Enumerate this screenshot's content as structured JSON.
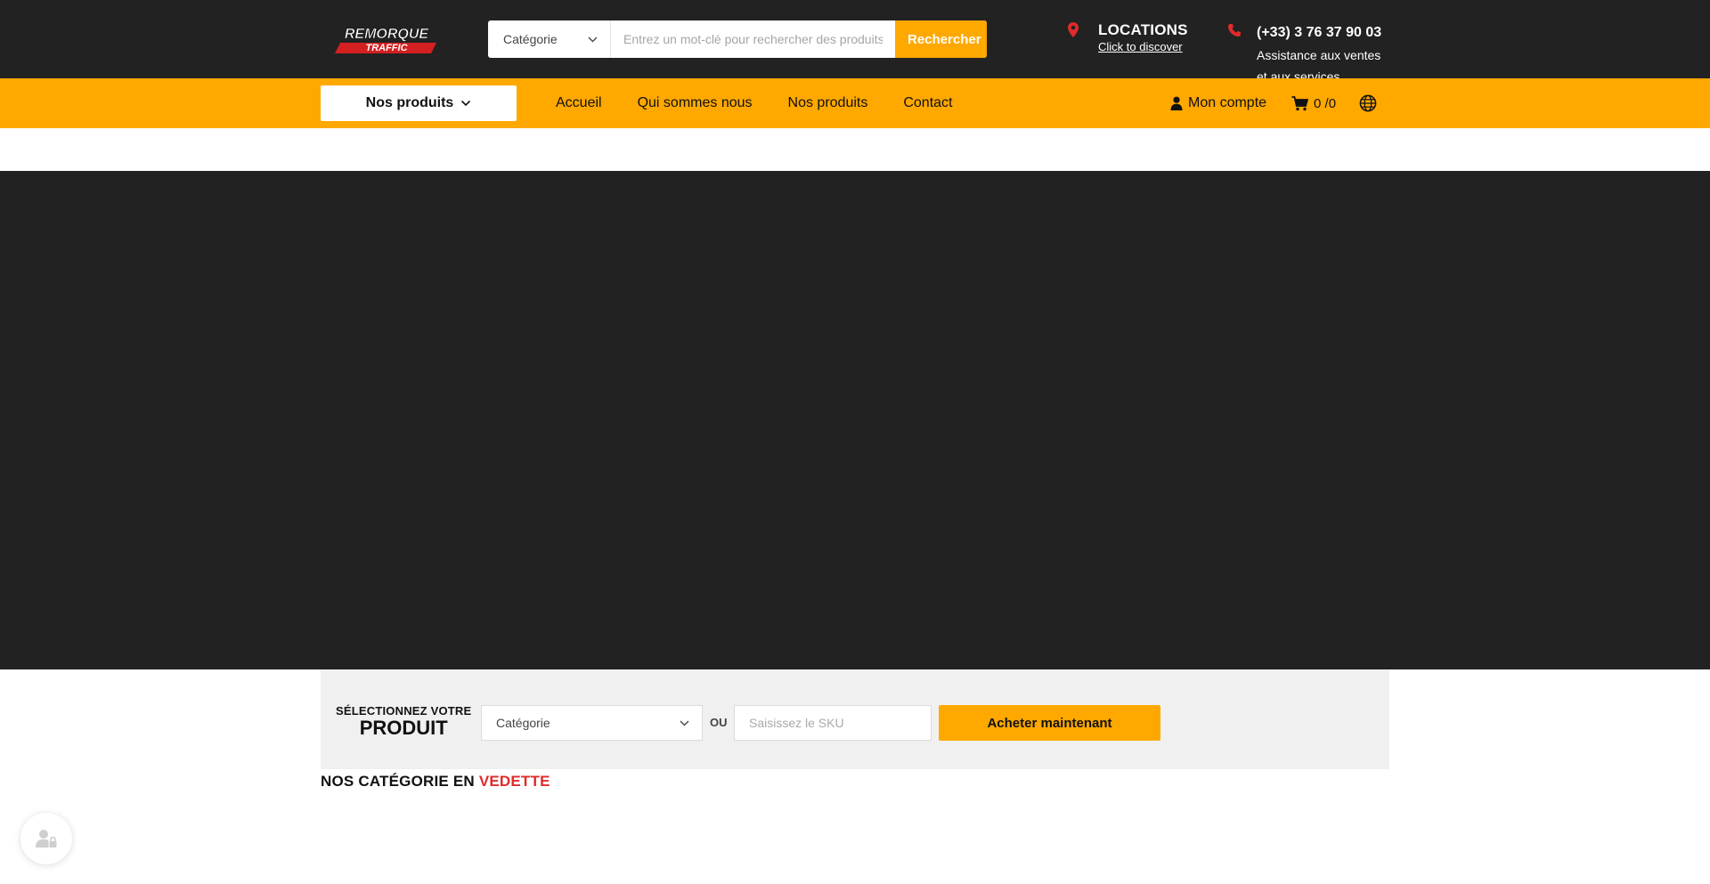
{
  "logo": {
    "line1": "REMORQUE",
    "line2": "TRAFFIC"
  },
  "search": {
    "category_label": "Catégorie",
    "placeholder": "Entrez un mot-clé pour rechercher des produits...",
    "button_label": "Rechercher"
  },
  "locations": {
    "title": "LOCATIONS",
    "link": "Click to discover"
  },
  "contact": {
    "phone": "(+33) 3 76 37 90 03",
    "subtitle": "Assistance aux ventes et aux services"
  },
  "navbar": {
    "products_button": "Nos produits",
    "links": [
      "Accueil",
      "Qui sommes nous",
      "Nos produits",
      "Contact"
    ],
    "account_label": "Mon compte",
    "cart_label": "0 /0"
  },
  "selector": {
    "label_line1": "SÉLECTIONNEZ VOTRE",
    "label_line2": "PRODUIT",
    "category_label": "Catégorie",
    "or_label": "OU",
    "sku_placeholder": "Saisissez le SKU",
    "button_label": "Acheter maintenant"
  },
  "featured": {
    "prefix": "NOS CATÉGORIE EN",
    "accent": "VEDETTE"
  },
  "colors": {
    "header_bg": "#222222",
    "accent_orange": "#ffa800",
    "accent_red": "#e02b2b",
    "selector_bg": "#f0f0f0"
  },
  "icons": [
    "location-pin-icon",
    "phone-icon",
    "chevron-down-icon",
    "user-icon",
    "cart-icon",
    "globe-icon",
    "privacy-icon"
  ]
}
